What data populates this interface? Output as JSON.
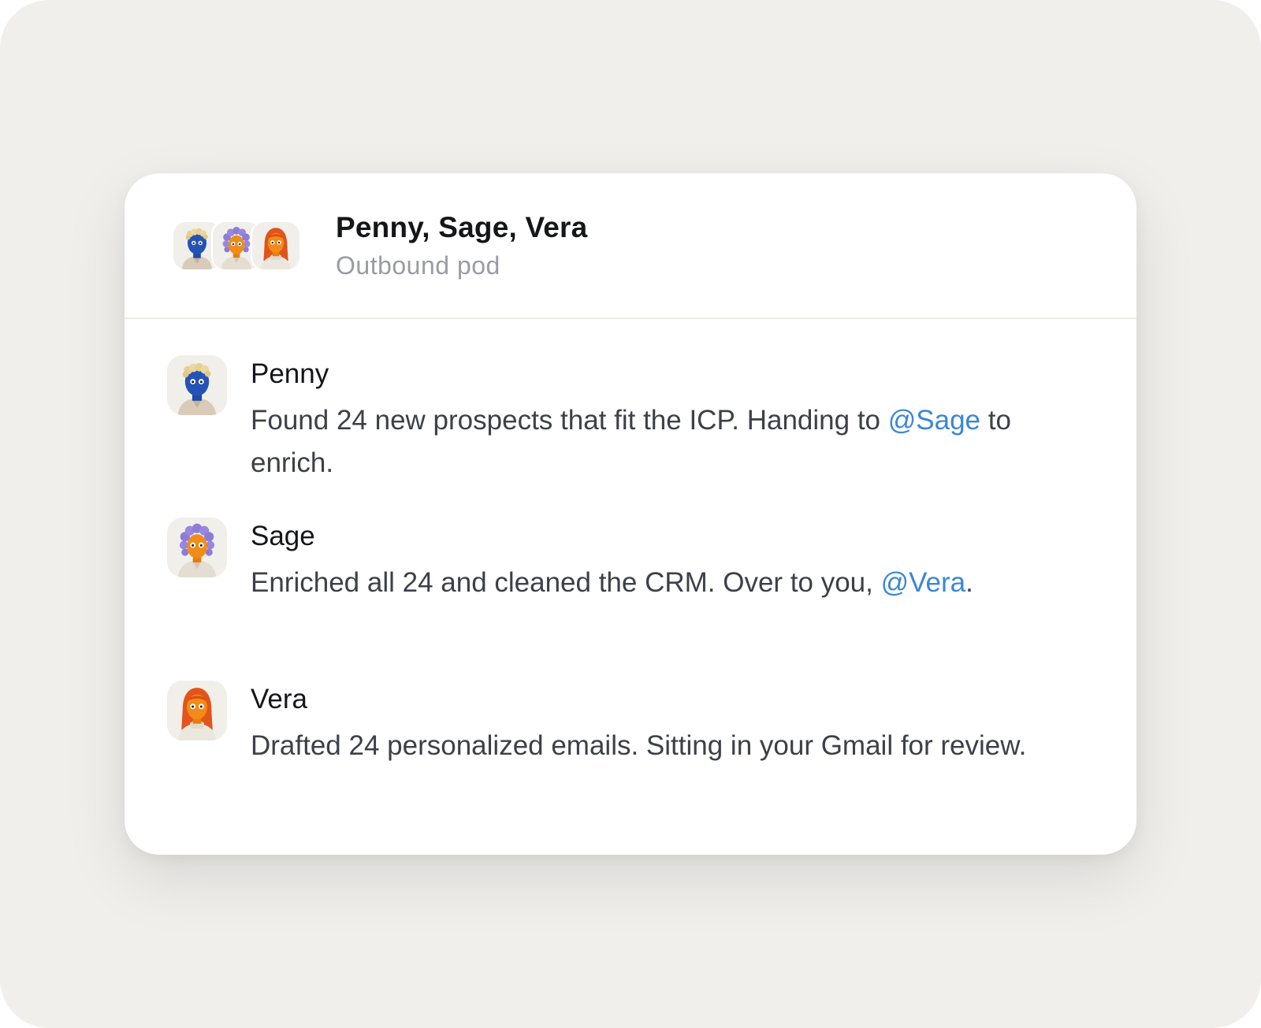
{
  "header": {
    "title": "Penny, Sage, Vera",
    "subtitle": "Outbound pod"
  },
  "messages": [
    {
      "author": "Penny",
      "avatar_icon": "penny-avatar-icon",
      "text_before": "Found 24 new prospects that fit the ICP. Handing to ",
      "mention": "@Sage",
      "text_after": " to enrich."
    },
    {
      "author": "Sage",
      "avatar_icon": "sage-avatar-icon",
      "text_before": "Enriched all 24 and cleaned the CRM. Over to you, ",
      "mention": "@Vera",
      "text_after": "."
    },
    {
      "author": "Vera",
      "avatar_icon": "vera-avatar-icon",
      "text_before": "Drafted 24 personalized emails. Sitting in your Gmail for review.",
      "mention": "",
      "text_after": ""
    }
  ],
  "colors": {
    "background": "#f0efec",
    "card": "#ffffff",
    "mention": "#3b87d4",
    "title": "#15161a",
    "subtitle": "#9a9ca2",
    "body_text": "#3e4048"
  }
}
